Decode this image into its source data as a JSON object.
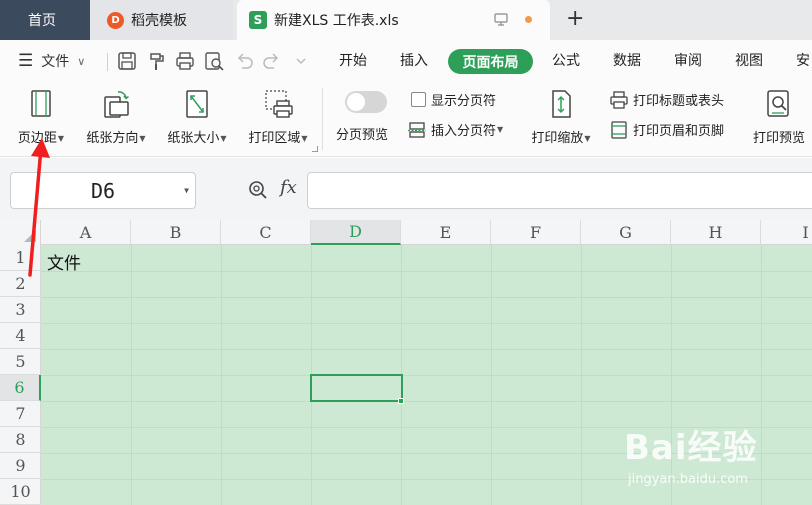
{
  "tabs": {
    "home": "首页",
    "template": "稻壳模板",
    "template_logo": "D",
    "workbook": "新建XLS 工作表.xls",
    "workbook_logo": "S",
    "new_tab": "+"
  },
  "menu": {
    "file": "文件",
    "items": [
      "开始",
      "插入",
      "页面布局",
      "公式",
      "数据",
      "审阅",
      "视图",
      "安"
    ],
    "active": "页面布局"
  },
  "ribbon": {
    "margins": "页边距",
    "orientation": "纸张方向",
    "size": "纸张大小",
    "print_area": "打印区域",
    "page_break_preview": "分页预览",
    "show_page_breaks": "显示分页符",
    "insert_page_break": "插入分页符",
    "print_scaling": "打印缩放",
    "print_titles": "打印标题或表头",
    "header_footer": "打印页眉和页脚",
    "print_preview": "打印预览"
  },
  "formula_bar": {
    "cell_ref": "D6",
    "fx": "fx",
    "formula": ""
  },
  "sheet": {
    "columns": [
      "A",
      "B",
      "C",
      "D",
      "E",
      "F",
      "G",
      "H",
      "I"
    ],
    "rows": [
      "1",
      "2",
      "3",
      "4",
      "5",
      "6",
      "7",
      "8",
      "9",
      "10"
    ],
    "active_column": "D",
    "active_row": "6",
    "cells": {
      "A1": "文件"
    },
    "cell_a1": "文件",
    "fill_color": "#cde8d3",
    "accent_color": "#2e9f58"
  },
  "watermark": {
    "main": "Bai经验",
    "sub": "jingyan.baidu.com"
  }
}
